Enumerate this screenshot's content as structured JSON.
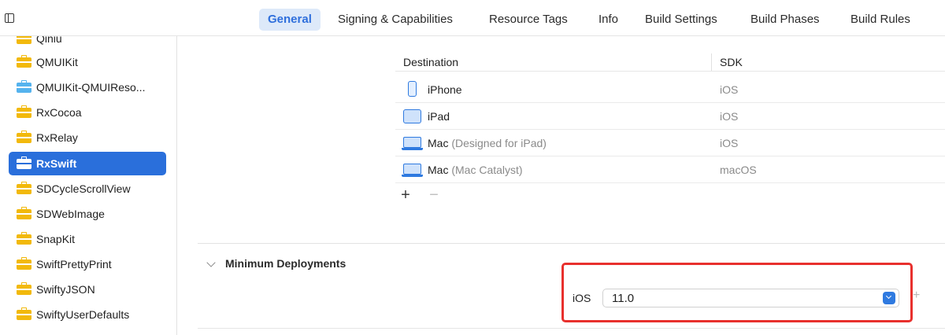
{
  "tabs": [
    {
      "label": "General",
      "active": true
    },
    {
      "label": "Signing & Capabilities",
      "active": false
    },
    {
      "label": "Resource Tags",
      "active": false
    },
    {
      "label": "Info",
      "active": false
    },
    {
      "label": "Build Settings",
      "active": false
    },
    {
      "label": "Build Phases",
      "active": false
    },
    {
      "label": "Build Rules",
      "active": false
    }
  ],
  "sidebar": {
    "items": [
      {
        "label": "Qiniu",
        "icon": "package-icon"
      },
      {
        "label": "QMUIKit",
        "icon": "package-icon"
      },
      {
        "label": "QMUIKit-QMUIReso...",
        "icon": "bundle-icon"
      },
      {
        "label": "RxCocoa",
        "icon": "package-icon"
      },
      {
        "label": "RxRelay",
        "icon": "package-icon"
      },
      {
        "label": "RxSwift",
        "icon": "package-icon",
        "selected": true
      },
      {
        "label": "SDCycleScrollView",
        "icon": "package-icon"
      },
      {
        "label": "SDWebImage",
        "icon": "package-icon"
      },
      {
        "label": "SnapKit",
        "icon": "package-icon"
      },
      {
        "label": "SwiftPrettyPrint",
        "icon": "package-icon"
      },
      {
        "label": "SwiftyJSON",
        "icon": "package-icon"
      },
      {
        "label": "SwiftyUserDefaults",
        "icon": "package-icon"
      }
    ]
  },
  "destinations": {
    "headers": {
      "destination": "Destination",
      "sdk": "SDK"
    },
    "rows": [
      {
        "device": "iPhone",
        "detail": "",
        "sdk": "iOS",
        "icon": "iphone-icon"
      },
      {
        "device": "iPad",
        "detail": "",
        "sdk": "iOS",
        "icon": "ipad-icon"
      },
      {
        "device": "Mac",
        "detail": "(Designed for iPad)",
        "sdk": "iOS",
        "icon": "mac-icon"
      },
      {
        "device": "Mac",
        "detail": "(Mac Catalyst)",
        "sdk": "macOS",
        "icon": "mac-icon"
      }
    ],
    "add_label": "+",
    "remove_label": "−"
  },
  "minimum_deployments": {
    "title": "Minimum Deployments",
    "platform": "iOS",
    "version": "11.0",
    "extra_add": "+"
  },
  "colors": {
    "accent": "#2a6fdb",
    "highlight": "#e8302d",
    "package": "#f2b90c",
    "bundle": "#55b3ee"
  }
}
